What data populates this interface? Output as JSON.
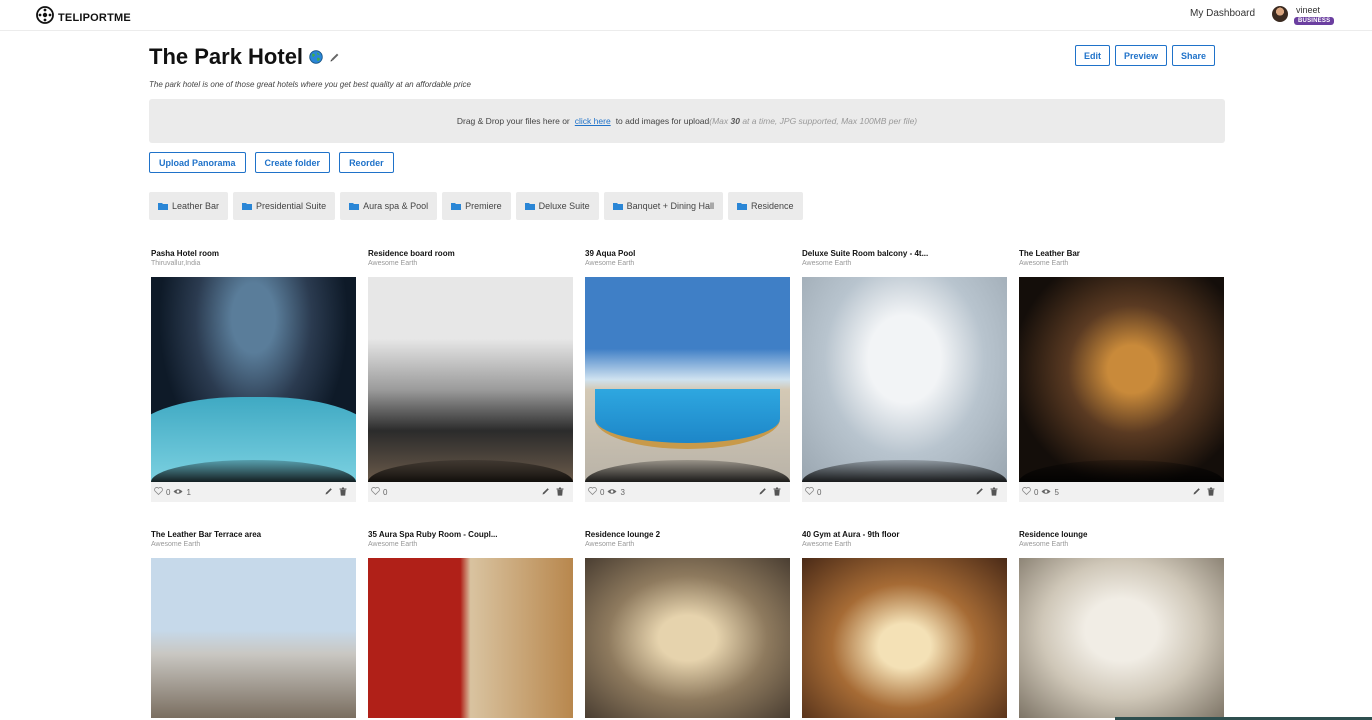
{
  "nav": {
    "brand": "TELIPORTME",
    "dashboard_link": "My Dashboard",
    "user_name": "vineet",
    "user_badge": "BUSINESS"
  },
  "header": {
    "title": "The Park Hotel",
    "subtitle": "The park hotel is one of those great hotels where you get best quality at an affordable price",
    "buttons": {
      "edit": "Edit",
      "preview": "Preview",
      "share": "Share"
    }
  },
  "upload": {
    "text_before": "Drag & Drop your files here or",
    "link": "click here",
    "text_after": "to add images for upload",
    "note_prefix": "(Max ",
    "note_max": "30",
    "note_suffix": " at a time, JPG supported, Max 100MB per file)"
  },
  "actions": {
    "upload_panorama": "Upload Panorama",
    "create_folder": "Create folder",
    "reorder": "Reorder"
  },
  "folders": [
    "Leather Bar",
    "Presidential Suite",
    "Aura spa & Pool",
    "Premiere",
    "Deluxe Suite",
    "Banquet + Dining Hall",
    "Residence"
  ],
  "panoramas": [
    {
      "title": "Pasha Hotel room",
      "location": "Thiruvallur,India",
      "likes": "0",
      "views": "1"
    },
    {
      "title": "Residence board room",
      "location": "Awesome Earth",
      "likes": "0",
      "views": ""
    },
    {
      "title": "39 Aqua Pool",
      "location": "Awesome Earth",
      "likes": "0",
      "views": "3"
    },
    {
      "title": "Deluxe Suite Room balcony - 4t...",
      "location": "Awesome Earth",
      "likes": "0",
      "views": ""
    },
    {
      "title": "The Leather Bar",
      "location": "Awesome Earth",
      "likes": "0",
      "views": "5"
    },
    {
      "title": "The Leather Bar Terrace area",
      "location": "Awesome Earth"
    },
    {
      "title": "35 Aura Spa Ruby Room - Coupl...",
      "location": "Awesome Earth"
    },
    {
      "title": "Residence lounge 2",
      "location": "Awesome Earth"
    },
    {
      "title": "40 Gym at Aura - 9th floor",
      "location": "Awesome Earth"
    },
    {
      "title": "Residence lounge",
      "location": "Awesome Earth"
    }
  ],
  "colors": {
    "accent": "#1f72c9",
    "badge": "#6b3fa0"
  },
  "icons": [
    "teliportme-logo-icon",
    "globe-icon",
    "pencil-icon",
    "folder-icon",
    "heart-icon",
    "eye-icon",
    "trash-icon"
  ]
}
